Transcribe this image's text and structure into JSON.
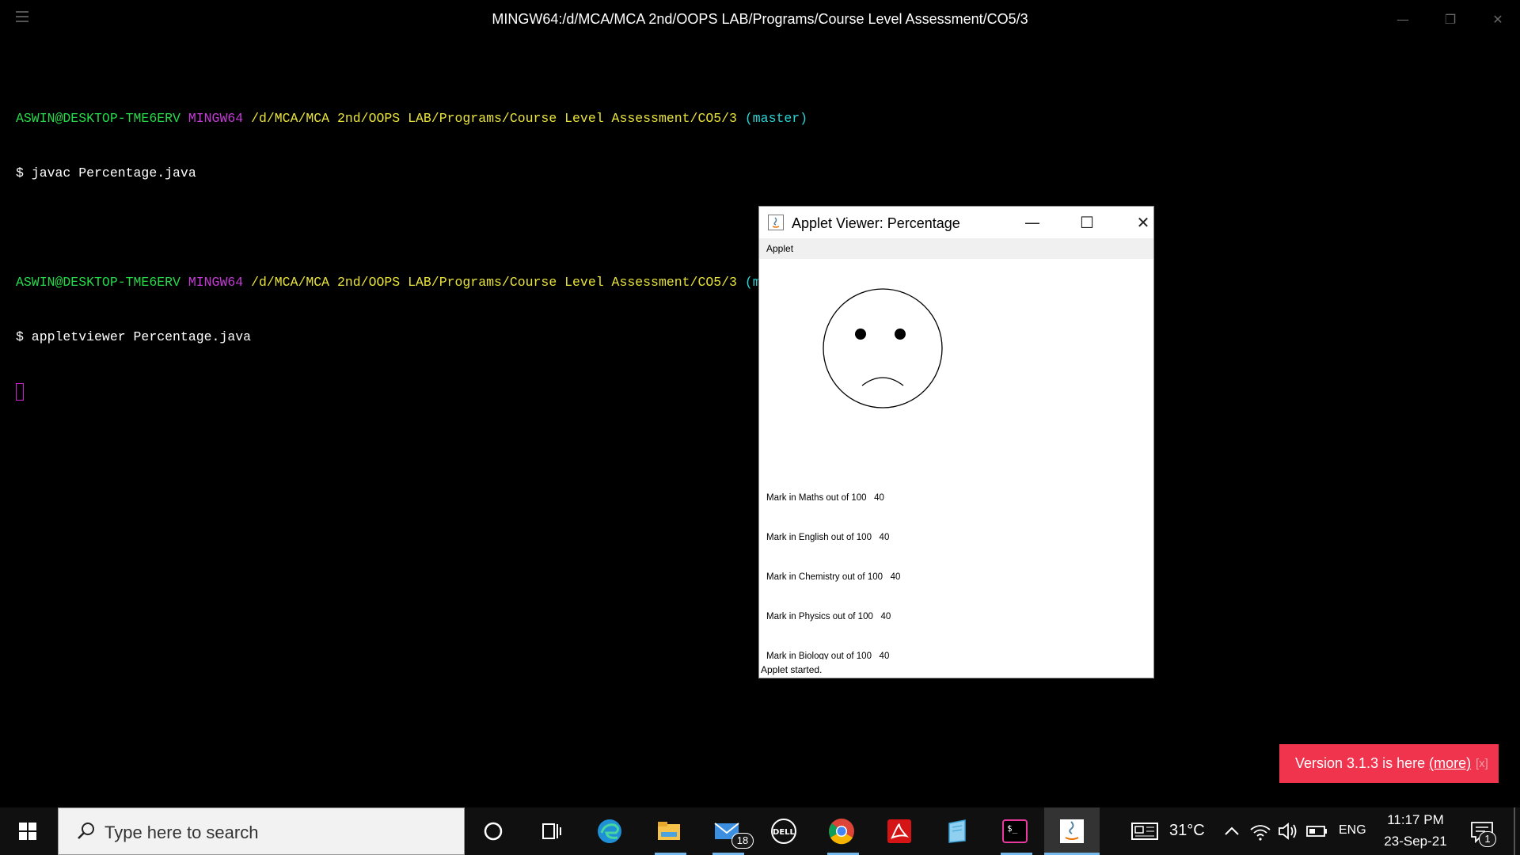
{
  "terminal": {
    "title": "MINGW64:/d/MCA/MCA 2nd/OOPS LAB/Programs/Course Level Assessment/CO5/3",
    "lines": [
      {
        "user": "ASWIN@DESKTOP-TME6ERV",
        "env": "MINGW64",
        "path": "/d/MCA/MCA 2nd/OOPS LAB/Programs/Course Level Assessment/CO5/3",
        "branch": "(master)",
        "command": "$ javac Percentage.java"
      },
      {
        "user": "ASWIN@DESKTOP-TME6ERV",
        "env": "MINGW64",
        "path": "/d/MCA/MCA 2nd/OOPS LAB/Programs/Course Level Assessment/CO5/3",
        "branch": "(master)",
        "command": "$ appletviewer Percentage.java"
      }
    ]
  },
  "applet": {
    "title": "Applet Viewer: Percentage",
    "menu": "Applet",
    "status": "Applet started.",
    "marks": [
      "Mark in Maths out of 100   40",
      "Mark in English out of 100   40",
      "Mark in Chemistry out of 100   40",
      "Mark in Physics out of 100   40",
      "Mark in Biology out of 100   40"
    ]
  },
  "toast": {
    "text": "Version 3.1.3 is here",
    "link": "(more)",
    "close": "[x]"
  },
  "taskbar": {
    "search_placeholder": "Type here to search",
    "mail_badge": "18",
    "temperature": "31°C",
    "language": "ENG",
    "time": "11:17 PM",
    "date": "23-Sep-21",
    "notification_badge": "1"
  },
  "colors": {
    "terminal_bg": "#000000",
    "user_green": "#26d84a",
    "env_magenta": "#c43bd6",
    "path_yellow": "#e8e33b",
    "branch_cyan": "#2ad4d4",
    "toast_bg": "#f0344e",
    "taskbar_bg": "#101010"
  }
}
